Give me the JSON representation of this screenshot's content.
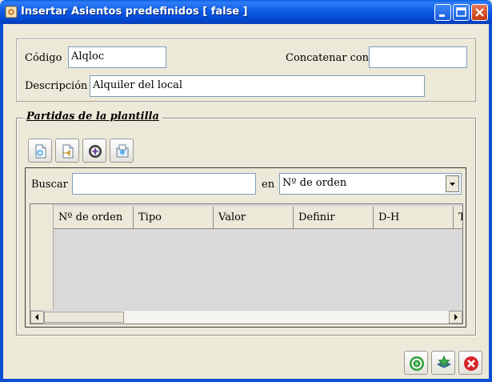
{
  "window": {
    "title": "Insertar Asientos predefinidos [ false ]"
  },
  "header": {
    "codigo_label": "Código",
    "codigo_value": "Alqloc",
    "concatenar_label": "Concatenar con",
    "concatenar_value": "",
    "descripcion_label": "Descripción",
    "descripcion_value": "Alquiler del local"
  },
  "group": {
    "title": "Partidas de la plantilla",
    "toolbar": [
      {
        "icon": "add-document-icon"
      },
      {
        "icon": "edit-document-icon"
      },
      {
        "icon": "delete-icon"
      },
      {
        "icon": "export-icon"
      }
    ]
  },
  "search": {
    "label": "Buscar",
    "value": "",
    "en_label": "en",
    "field_selected": "Nº de orden"
  },
  "table": {
    "columns": [
      "Nº de orden",
      "Tipo",
      "Valor",
      "Definir",
      "D-H",
      "T"
    ],
    "rows": []
  },
  "footer": [
    {
      "icon": "accept-icon"
    },
    {
      "icon": "insert-icon"
    },
    {
      "icon": "cancel-icon"
    }
  ],
  "colors": {
    "titlebar": "#0148d2",
    "background": "#ece9d8",
    "table_body": "#d9d9d9"
  }
}
